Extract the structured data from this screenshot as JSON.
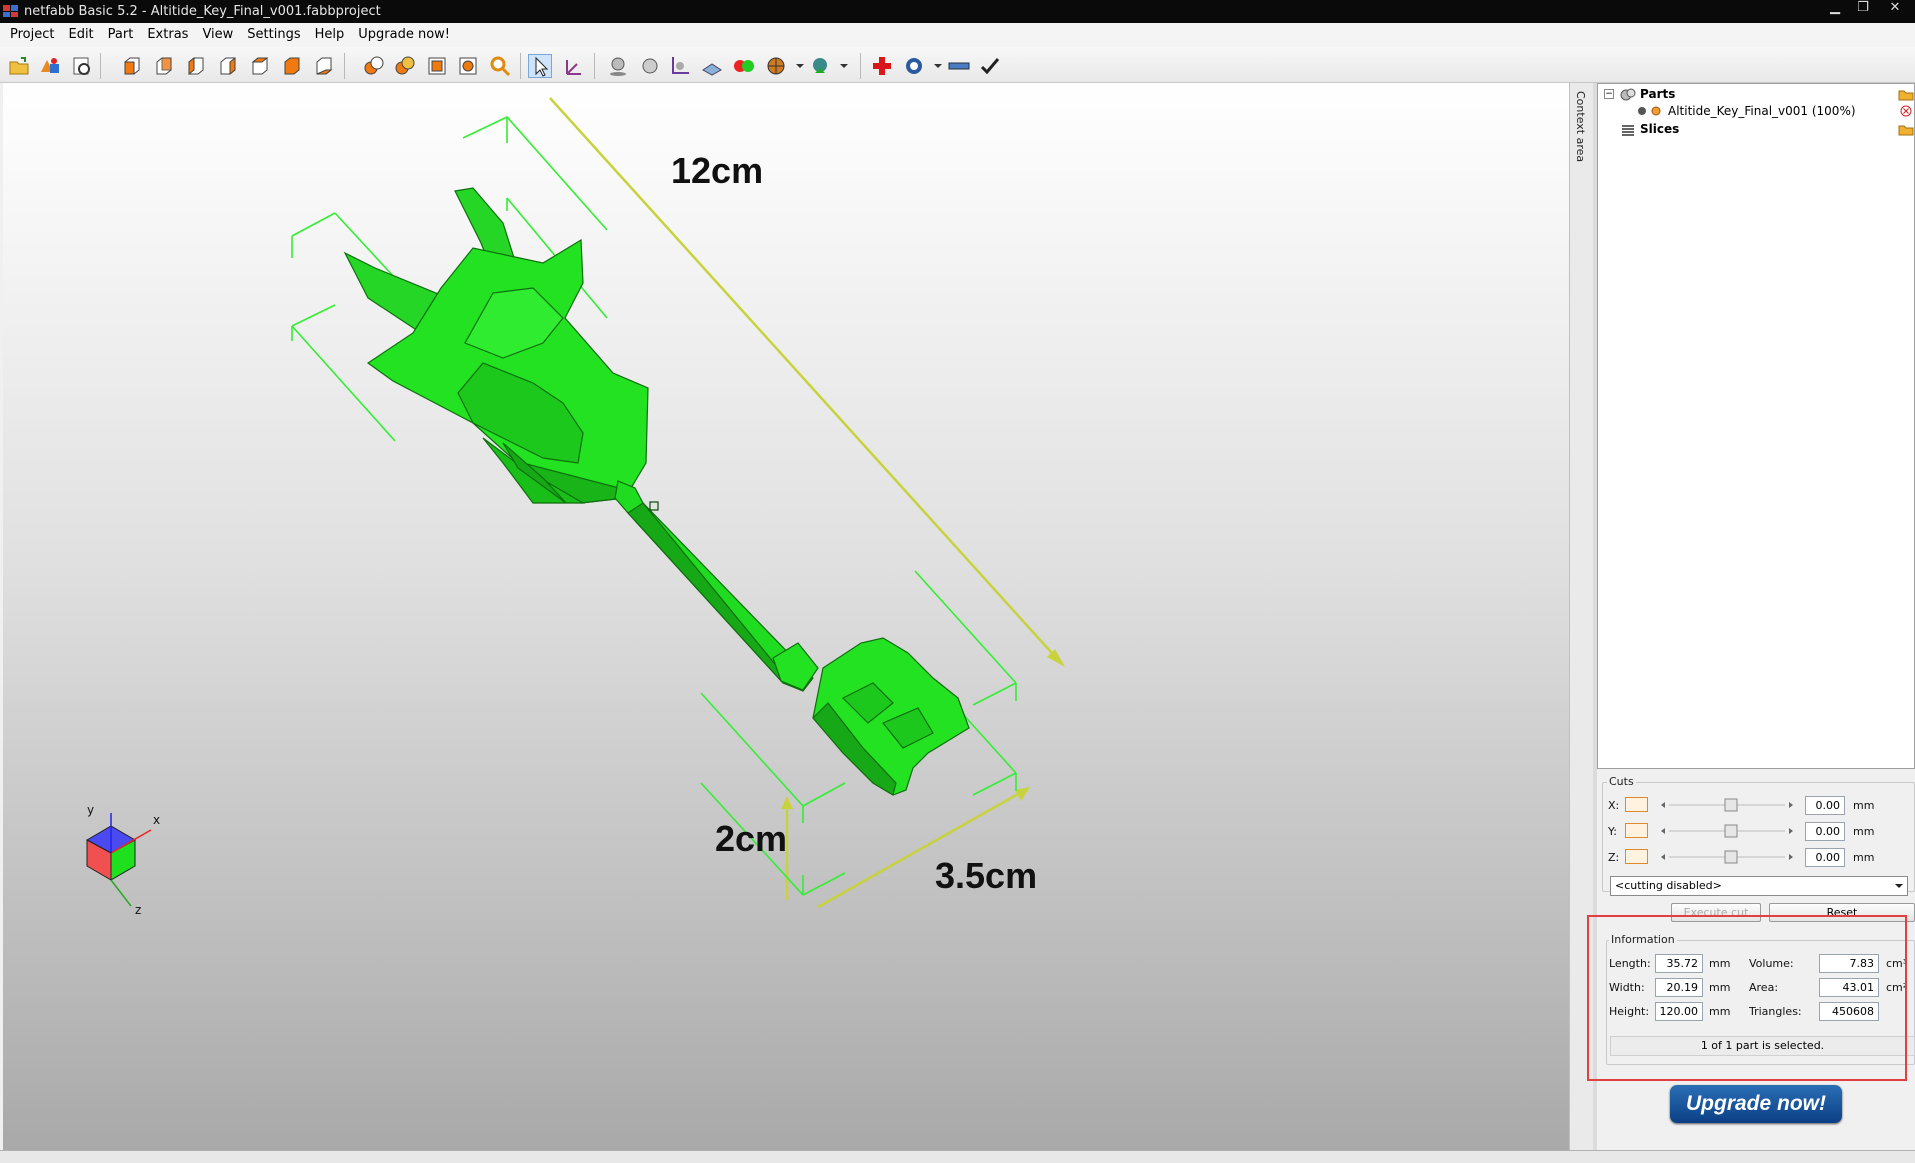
{
  "window": {
    "title": "netfabb Basic 5.2 - Altitide_Key_Final_v001.fabbproject",
    "minimize": "▁",
    "maximize": "❐",
    "close": "✕"
  },
  "menu": [
    "Project",
    "Edit",
    "Part",
    "Extras",
    "View",
    "Settings",
    "Help",
    "Upgrade now!"
  ],
  "viewport": {
    "labels": {
      "length": "12cm",
      "height": "2cm",
      "width": "3.5cm"
    },
    "axes": {
      "x": "x",
      "y": "y",
      "z": "z"
    },
    "colors": {
      "model": "#1fe01f",
      "dimension_line": "#c8d23c",
      "bracket": "#33ee33"
    }
  },
  "context_area": {
    "label": "Context area"
  },
  "tree": {
    "parts_label": "Parts",
    "part_item": "Altitide_Key_Final_v001 (100%)",
    "slices_label": "Slices"
  },
  "cuts": {
    "title": "Cuts",
    "x_label": "X:",
    "y_label": "Y:",
    "z_label": "Z:",
    "x_value": "0.00",
    "y_value": "0.00",
    "z_value": "0.00",
    "unit": "mm",
    "mode": "<cutting disabled>",
    "execute_label": "Execute cut",
    "reset_label": "Reset"
  },
  "information": {
    "title": "Information",
    "length_label": "Length:",
    "length_value": "35.72",
    "width_label": "Width:",
    "width_value": "20.19",
    "height_label": "Height:",
    "height_value": "120.00",
    "mm": "mm",
    "volume_label": "Volume:",
    "volume_value": "7.83",
    "volume_unit": "cm³",
    "area_label": "Area:",
    "area_value": "43.01",
    "area_unit": "cm²",
    "triangles_label": "Triangles:",
    "triangles_value": "450608",
    "selection_status": "1 of 1 part is selected."
  },
  "upgrade_button": "Upgrade now!"
}
